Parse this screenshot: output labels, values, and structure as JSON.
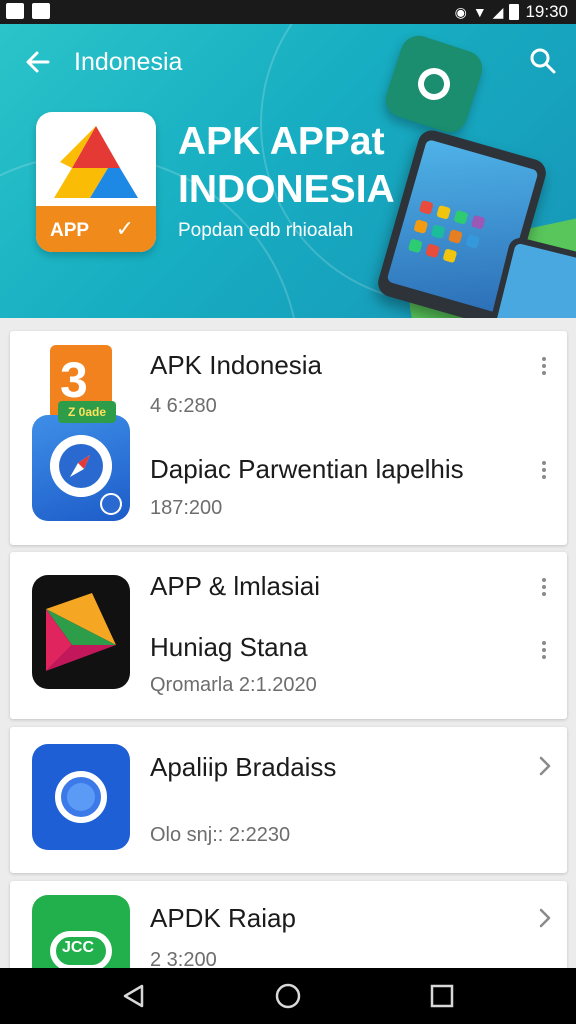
{
  "status_bar": {
    "time": "19:30",
    "icons": [
      "image-icon",
      "notification-icon",
      "location-icon",
      "wifi-icon",
      "signal-icon",
      "battery-icon"
    ]
  },
  "toolbar": {
    "title": "Indonesia",
    "back_icon": "arrow-left-icon",
    "search_icon": "search-icon"
  },
  "banner": {
    "headline_line1": "APK APPat",
    "headline_line2": "INDONESIA",
    "subtitle": "Popdan edb rhioalah",
    "logo_label": "APP"
  },
  "apps": [
    {
      "title": "APK Indonesia",
      "meta": "4 6:280",
      "action": "more"
    },
    {
      "title": "Dapiac Parwentian lapelhis",
      "meta": "187:200",
      "action": "more"
    },
    {
      "title": "APP & lmlasiai",
      "meta": "",
      "action": "more"
    },
    {
      "title": "Huniag Stana",
      "meta": "Qromarla 2:1.2020",
      "action": "more"
    },
    {
      "title": "Apaliip Bradaiss",
      "meta": "Olo snj:: 2:2230",
      "action": "chevron"
    },
    {
      "title": "APDK Raiap",
      "meta": "2 3:200",
      "action": "chevron"
    }
  ],
  "icon_text": {
    "orange_number": "3",
    "orange_tag": "Z 0ade",
    "green_text": "JCC"
  },
  "colors": {
    "banner": "#1ab3c6",
    "accent_orange": "#f08a1b",
    "accent_green": "#21b04b",
    "accent_blue": "#1e5fd6"
  },
  "nav": {
    "back": "back-triangle-icon",
    "home": "home-circle-icon",
    "recents": "recents-square-icon"
  }
}
